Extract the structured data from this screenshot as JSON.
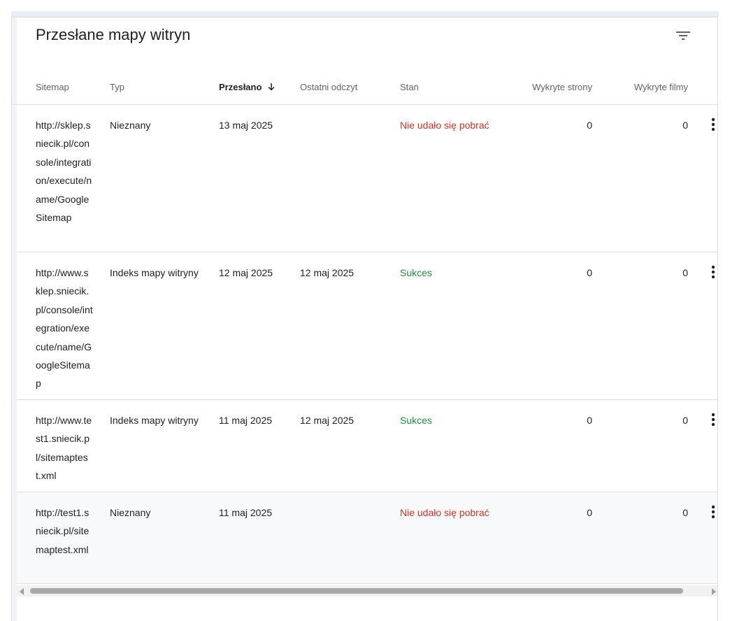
{
  "card": {
    "title": "Przesłane mapy witryn"
  },
  "table": {
    "headers": {
      "sitemap": "Sitemap",
      "type": "Typ",
      "submitted": "Przesłano",
      "last_read": "Ostatni odczyt",
      "status": "Stan",
      "pages": "Wykryte strony",
      "videos": "Wykryte filmy"
    },
    "sort": {
      "column": "submitted",
      "direction": "descending"
    },
    "rows": [
      {
        "url": "http://sklep.sniecik.pl/console/integration/execute/name/GoogleSitemap",
        "type": "Nieznany",
        "submitted": "13 maj 2025",
        "last_read": "",
        "status": "Nie udało się pobrać",
        "pages": "0",
        "videos": "0"
      },
      {
        "url": "http://www.sklep.sniecik.pl/console/integration/execute/name/GoogleSitemap",
        "type": "Indeks mapy witryny",
        "submitted": "12 maj 2025",
        "last_read": "12 maj 2025",
        "status": "Sukces",
        "pages": "0",
        "videos": "0"
      },
      {
        "url": "http://www.test1.sniecik.pl/sitemaptest.xml",
        "type": "Indeks mapy witryny",
        "submitted": "11 maj 2025",
        "last_read": "12 maj 2025",
        "status": "Sukces",
        "pages": "0",
        "videos": "0"
      },
      {
        "url": "http://test1.sniecik.pl/sitemaptest.xml",
        "type": "Nieznany",
        "submitted": "11 maj 2025",
        "last_read": "",
        "status": "Nie udało się pobrać",
        "pages": "0",
        "videos": "0"
      }
    ]
  },
  "icons": {
    "filter": "filter-icon",
    "sort": "arrow-down-icon",
    "row_menu": "more-vert-icon"
  },
  "colors": {
    "error": "#d93025",
    "success": "#1e8e3e",
    "hovered_row_bg": "#f8f9fa"
  }
}
